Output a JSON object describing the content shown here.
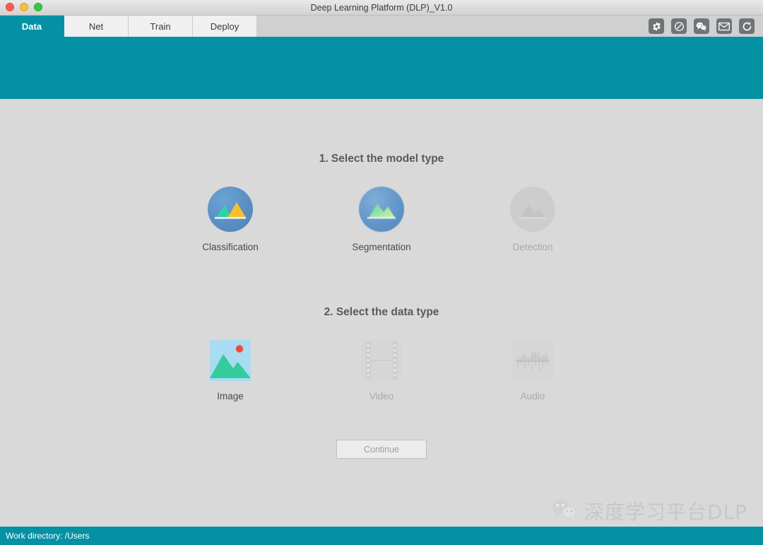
{
  "window": {
    "title": "Deep Learning Platform (DLP)_V1.0",
    "traffic_lights": [
      "close-button",
      "minimize-button",
      "zoom-button"
    ]
  },
  "tabs": [
    {
      "label": "Data",
      "active": true
    },
    {
      "label": "Net",
      "active": false
    },
    {
      "label": "Train",
      "active": false
    },
    {
      "label": "Deploy",
      "active": false
    }
  ],
  "toolbar_icons": [
    {
      "name": "gear-icon",
      "glyph": "settings"
    },
    {
      "name": "compass-icon",
      "glyph": "browser"
    },
    {
      "name": "wechat-icon",
      "glyph": "wechat"
    },
    {
      "name": "mail-icon",
      "glyph": "envelope"
    },
    {
      "name": "refresh-icon",
      "glyph": "sync"
    }
  ],
  "main": {
    "model_section": {
      "title": "1. Select the model type",
      "options": [
        {
          "label": "Classification",
          "icon": "classification-icon",
          "enabled": true,
          "selected": false
        },
        {
          "label": "Segmentation",
          "icon": "segmentation-icon",
          "enabled": true,
          "selected": true
        },
        {
          "label": "Detection",
          "icon": "detection-icon",
          "enabled": false,
          "selected": false
        }
      ]
    },
    "data_section": {
      "title": "2. Select the data type",
      "options": [
        {
          "label": "Image",
          "icon": "image-icon",
          "enabled": true,
          "selected": true
        },
        {
          "label": "Video",
          "icon": "video-icon",
          "enabled": false,
          "selected": false
        },
        {
          "label": "Audio",
          "icon": "audio-icon",
          "enabled": false,
          "selected": false
        }
      ]
    },
    "continue_button": {
      "label": "Continue",
      "enabled": false
    }
  },
  "watermark": {
    "text": "深度学习平台DLP",
    "icon": "wechat-icon"
  },
  "statusbar": {
    "text": "Work directory: /Users"
  },
  "colors": {
    "accent_teal": "#0591a4",
    "window_chrome": "#d8d8d8",
    "content_bg": "#d9d9d9",
    "tab_inactive_bg": "#f0f0f0",
    "disabled_text": "#a9a9a9"
  }
}
